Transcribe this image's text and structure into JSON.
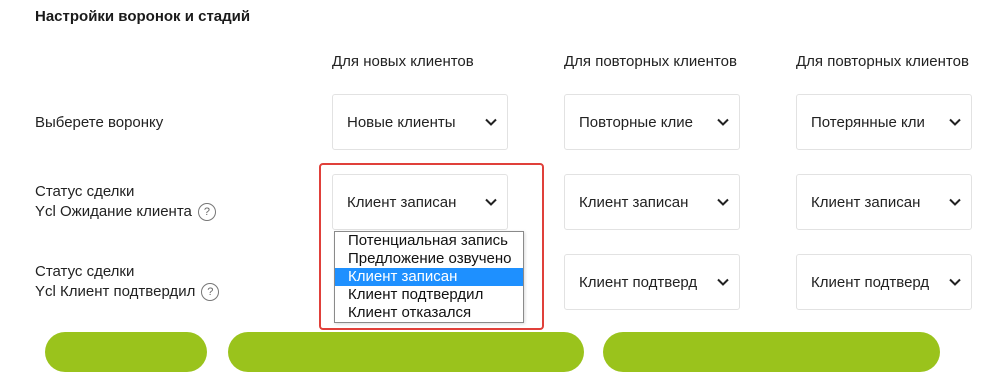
{
  "title": "Настройки воронок и стадий",
  "columns": [
    "Для новых клиентов",
    "Для повторных клиентов",
    "Для повторных клиентов"
  ],
  "rows": {
    "funnel": {
      "label": "Выберете воронку"
    },
    "status_waiting": {
      "line1": "Статус сделки",
      "line2": "Ycl Ожидание клиента"
    },
    "status_confirmed": {
      "line1": "Статус сделки",
      "line2": "Ycl Клиент подтвердил"
    }
  },
  "help_glyph": "?",
  "selects": {
    "funnel_new": "Новые клиенты",
    "funnel_repeat": "Повторные клие",
    "funnel_lost": "Потерянные кли",
    "waiting_new": "Клиент записан",
    "waiting_repeat": "Клиент записан",
    "waiting_lost": "Клиент записан",
    "confirmed_repeat": "Клиент подтверд",
    "confirmed_lost": "Клиент подтверд"
  },
  "dropdown_options": [
    "Потенциальная запись",
    "Предложение озвучено",
    "Клиент записан",
    "Клиент подтвердил",
    "Клиент отказался"
  ],
  "selected_option_index": 2,
  "colors": {
    "selected_option": "#1e90ff",
    "highlight_border": "#e0403a",
    "button_green": "#9ac31c"
  },
  "icons": {
    "chevron": "chevron-down-icon",
    "help": "help-circle-icon"
  }
}
